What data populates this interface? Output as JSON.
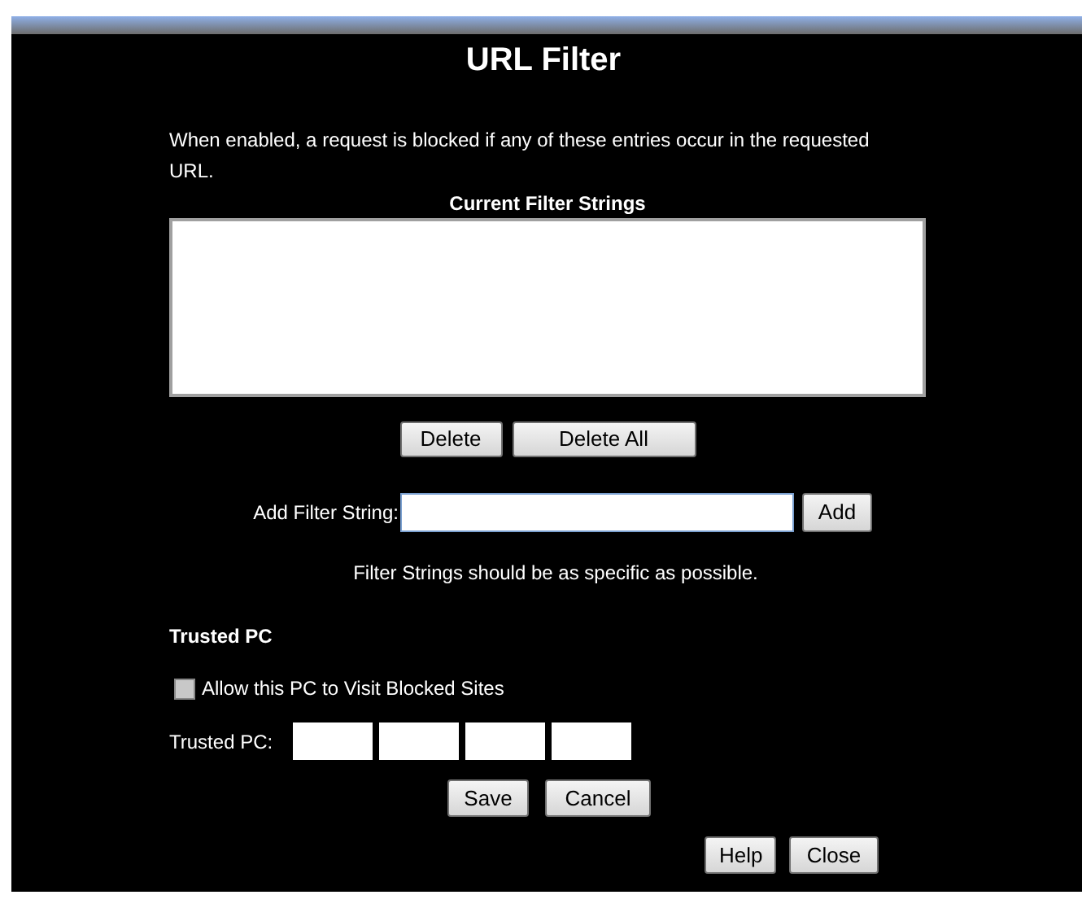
{
  "title": "URL Filter",
  "description": "When enabled, a request is blocked if any of these entries occur in the requested URL.",
  "filter_list": {
    "label": "Current Filter Strings"
  },
  "list_buttons": [
    "Delete",
    "Delete All"
  ],
  "add_filter": {
    "label": "Add Filter String:",
    "button": "Add"
  },
  "hint": "Filter Strings should be as specific as possible.",
  "trusted_pc": {
    "heading": "Trusted PC",
    "checkbox": {
      "label": "Allow this PC to Visit Blocked Sites",
      "checked": false
    },
    "ip_label": "Trusted PC:"
  },
  "form_buttons": [
    "Save",
    "Cancel"
  ],
  "footer_buttons": [
    "Help",
    "Close"
  ]
}
